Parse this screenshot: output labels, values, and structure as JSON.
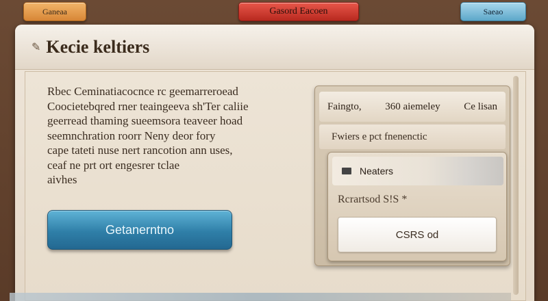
{
  "top_buttons": {
    "left": "Ganeaa",
    "center": "Gasord Eacoen",
    "right": "Saeao"
  },
  "window": {
    "title": "Kecie keltiers"
  },
  "description": {
    "lines": [
      "Rbec Ceminatiacocnce rc geemarreroead",
      "Coocietebqred rner teaingeeva sh'Ter caliie",
      "geerread thaming sueemsora teaveer hoad",
      "seemnchration roorr Neny deor fory",
      "cape tateti nuse nert rancotion ann uses,",
      "ceaf ne prt ort engesrer tclae",
      "aivhes"
    ]
  },
  "primary_button": {
    "label": "Getanerntno"
  },
  "side_panel": {
    "header_left": "Faingto,",
    "header_mid": "360 aiemeley",
    "header_right": "Ce lisan",
    "subheader": "Fwiers e pct fnenenctic",
    "card_row_label": "Neaters",
    "card_label": "Rcrartsod S!S *",
    "card_button": "CSRS od"
  }
}
